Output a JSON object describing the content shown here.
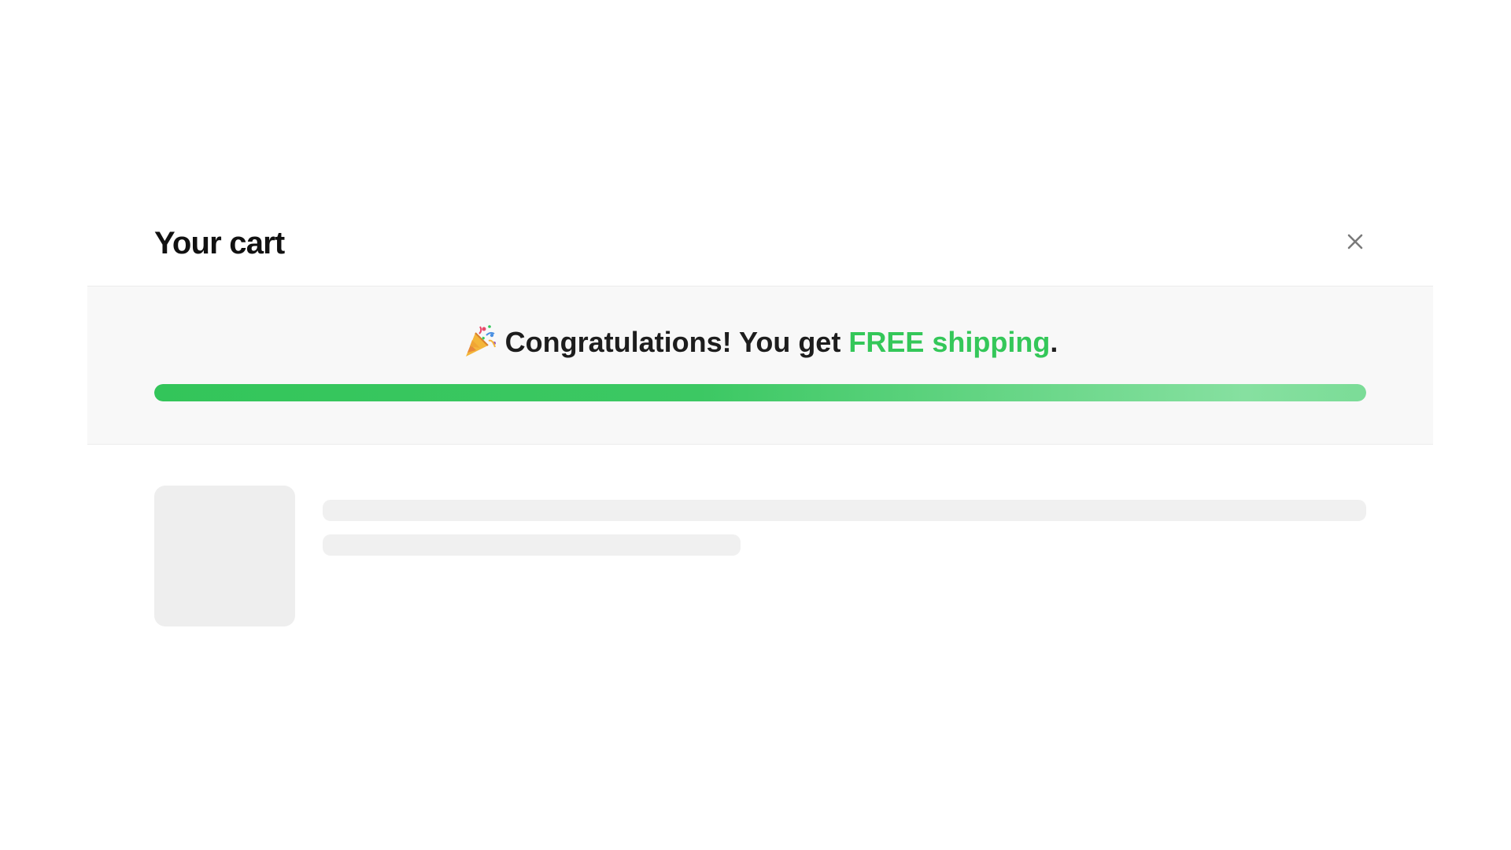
{
  "cart": {
    "title": "Your cart",
    "close_icon": "close-icon"
  },
  "shipping_banner": {
    "icon": "party-popper-icon",
    "message_prefix": "Congratulations! You get ",
    "message_highlight": "FREE shipping",
    "message_suffix": ".",
    "highlight_color": "#34c759",
    "progress_percent": 100,
    "progress_colors": [
      "#33c55a",
      "#86e0a0"
    ]
  },
  "cart_items": {
    "state": "loading-skeleton",
    "skeleton_color": "#eeeeee"
  }
}
